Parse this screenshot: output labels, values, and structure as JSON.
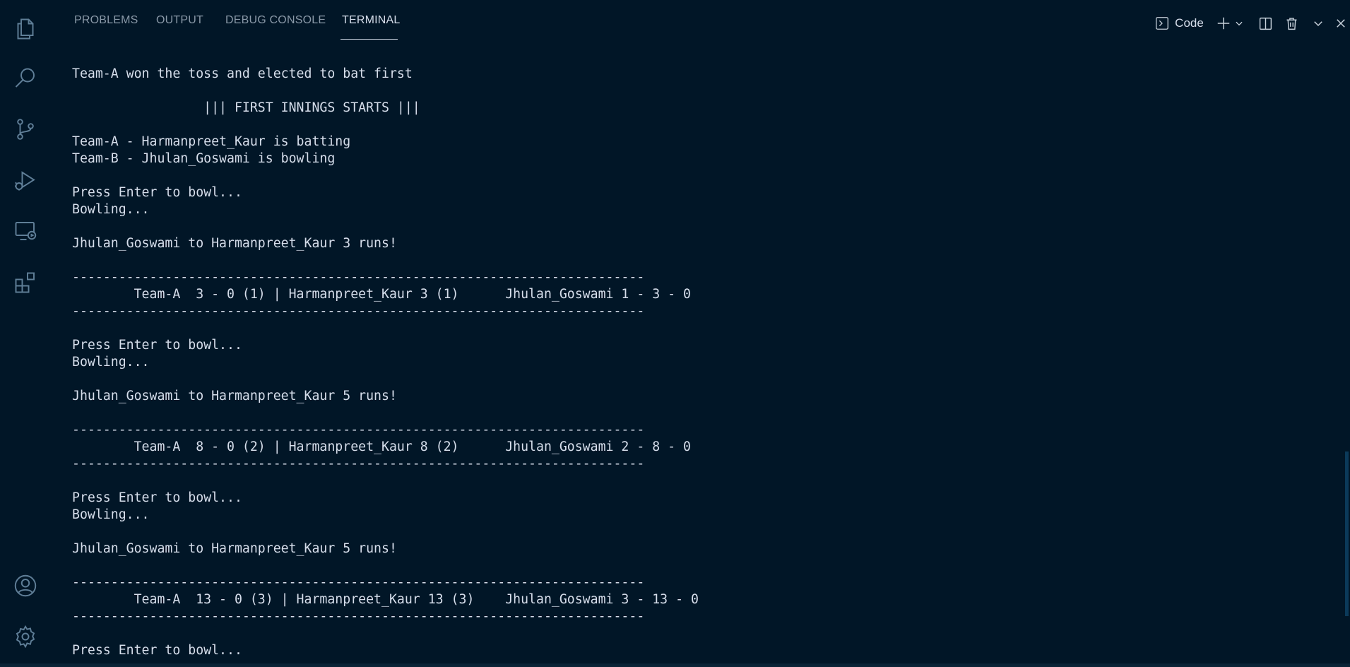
{
  "tabs": [
    {
      "label": "PROBLEMS"
    },
    {
      "label": "OUTPUT"
    },
    {
      "label": "DEBUG CONSOLE"
    },
    {
      "label": "TERMINAL"
    }
  ],
  "active_tab": "TERMINAL",
  "toolbar": {
    "terminal_profile_label": "Code"
  },
  "icons": {
    "activity_bar": [
      "explorer-icon",
      "search-icon",
      "source-control-icon",
      "run-debug-icon",
      "remote-explorer-icon",
      "extensions-icon",
      "account-icon",
      "manage-gear-icon"
    ],
    "toolbar": [
      "terminal-icon",
      "plus-icon",
      "chevron-down-icon",
      "split-icon",
      "trash-icon",
      "chevron-down-icon",
      "close-icon"
    ]
  },
  "colors": {
    "background": "#011627",
    "text": "#d6deeb",
    "tab_inactive": "#8a99a8"
  },
  "terminal": {
    "lines": [
      "Team-A won the toss and elected to bat first",
      "",
      "                 ||| FIRST INNINGS STARTS |||",
      "",
      "Team-A - Harmanpreet_Kaur is batting",
      "Team-B - Jhulan_Goswami is bowling",
      "",
      "Press Enter to bowl...",
      "Bowling...",
      "",
      "Jhulan_Goswami to Harmanpreet_Kaur 3 runs!",
      "",
      "--------------------------------------------------------------------------",
      "        Team-A  3 - 0 (1) | Harmanpreet_Kaur 3 (1)      Jhulan_Goswami 1 - 3 - 0",
      "--------------------------------------------------------------------------",
      "",
      "Press Enter to bowl...",
      "Bowling...",
      "",
      "Jhulan_Goswami to Harmanpreet_Kaur 5 runs!",
      "",
      "--------------------------------------------------------------------------",
      "        Team-A  8 - 0 (2) | Harmanpreet_Kaur 8 (2)      Jhulan_Goswami 2 - 8 - 0",
      "--------------------------------------------------------------------------",
      "",
      "Press Enter to bowl...",
      "Bowling...",
      "",
      "Jhulan_Goswami to Harmanpreet_Kaur 5 runs!",
      "",
      "--------------------------------------------------------------------------",
      "        Team-A  13 - 0 (3) | Harmanpreet_Kaur 13 (3)    Jhulan_Goswami 3 - 13 - 0",
      "--------------------------------------------------------------------------",
      "",
      "Press Enter to bowl..."
    ]
  }
}
